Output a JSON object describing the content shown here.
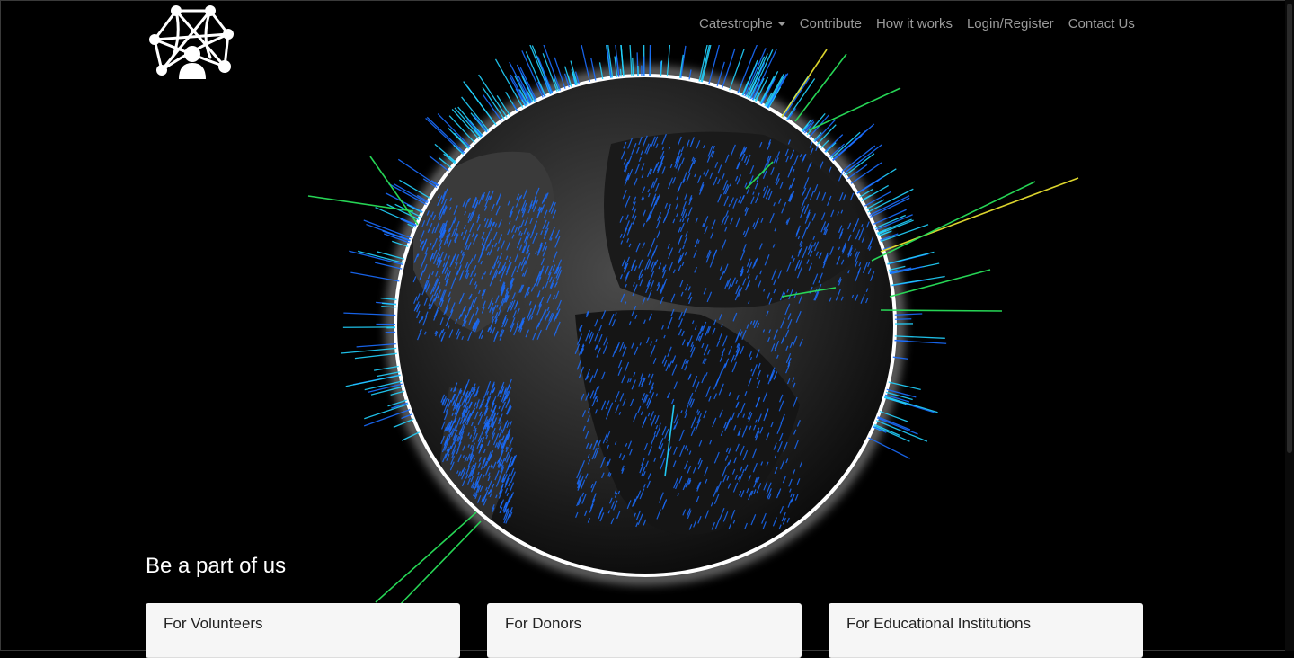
{
  "nav": {
    "items": [
      {
        "label": "Catestrophe",
        "dropdown": true
      },
      {
        "label": "Contribute"
      },
      {
        "label": "How it works"
      },
      {
        "label": "Login/Register"
      },
      {
        "label": "Contact Us"
      }
    ]
  },
  "main": {
    "section_title": "Be a part of us",
    "cards": [
      {
        "title": "For Volunteers"
      },
      {
        "title": "For Donors"
      },
      {
        "title": "For Educational Institutions"
      }
    ]
  },
  "colors": {
    "background": "#000000",
    "nav_text": "#9a9a9a",
    "bar_blue": "#1a6dff",
    "bar_cyan": "#22d3ff",
    "bar_green": "#29e05a",
    "bar_yellow": "#e8e030",
    "card_bg": "#f6f6f6"
  },
  "icons": {
    "logo": "network-person-logo"
  }
}
